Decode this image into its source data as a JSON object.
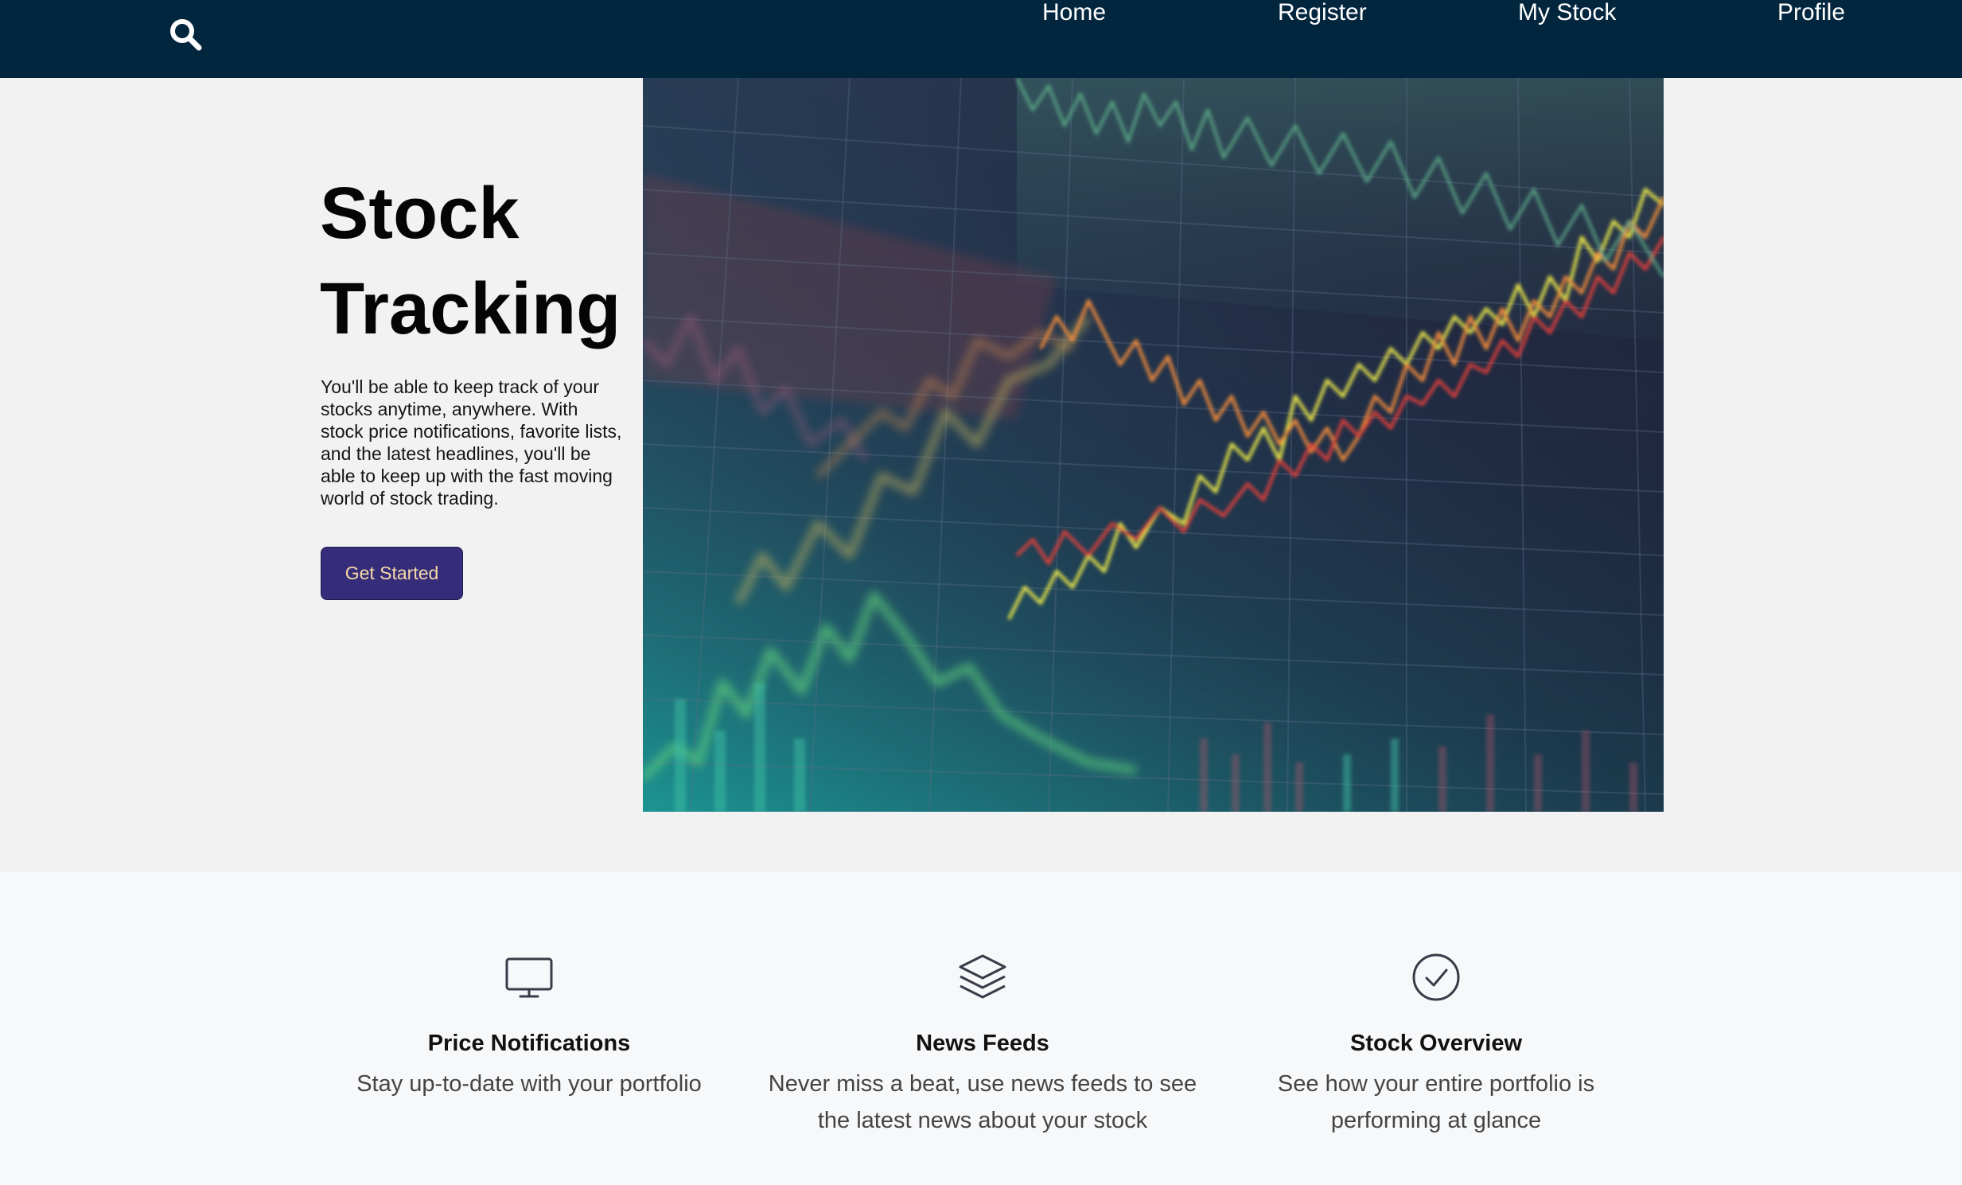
{
  "nav": {
    "search_icon": "search-icon",
    "links": [
      "Home",
      "Register",
      "My Stock",
      "Profile"
    ]
  },
  "hero": {
    "title": "Stock Tracking",
    "description": "You'll be able to keep track of your stocks anytime, anywhere. With stock price notifications, favorite lists, and the latest headlines, you'll be able to keep up with the fast moving world of stock trading.",
    "button_label": "Get Started"
  },
  "features": [
    {
      "icon": "monitor-icon",
      "title": "Price Notifications",
      "description": "Stay up-to-date with your portfolio"
    },
    {
      "icon": "layers-icon",
      "title": "News Feeds",
      "description": "Never miss a beat, use news feeds to see the latest news about your stock"
    },
    {
      "icon": "check-circle-icon",
      "title": "Stock Overview",
      "description": "See how your entire portfolio is performing at glance"
    }
  ],
  "colors": {
    "nav_bg": "#03263f",
    "button_bg": "#362d7a",
    "button_text": "#f4d9a8",
    "hero_bg": "#f2f2f2",
    "features_bg": "#f7f8fa"
  }
}
